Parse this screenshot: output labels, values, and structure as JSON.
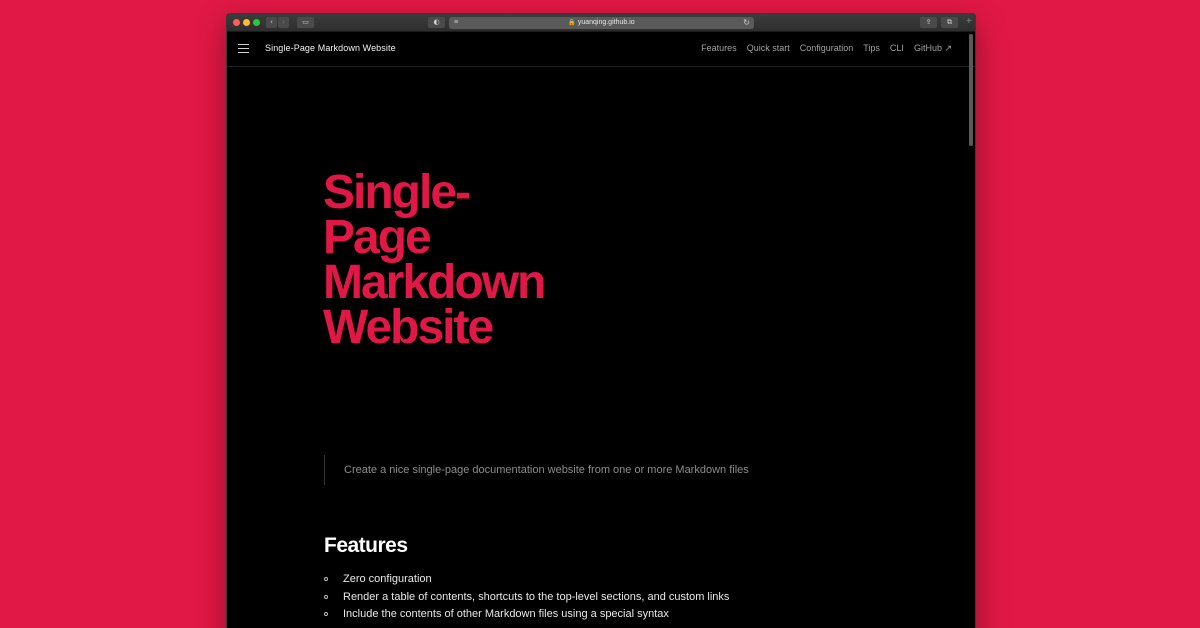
{
  "browser": {
    "url": "yuanqing.github.io"
  },
  "nav": {
    "site_title": "Single-Page Markdown Website",
    "links": [
      "Features",
      "Quick start",
      "Configuration",
      "Tips",
      "CLI",
      "GitHub ↗"
    ]
  },
  "hero": {
    "lines": [
      "Single-",
      "Page",
      "Markdown",
      "Website"
    ]
  },
  "subtitle": "Create a nice single-page documentation website from one or more Markdown files",
  "features": {
    "heading": "Features",
    "items": [
      "Zero configuration",
      "Render a table of contents, shortcuts to the top-level sections, and custom links",
      "Include the contents of other Markdown files using a special syntax"
    ]
  },
  "colors": {
    "brand": "#e11845",
    "background": "#000000"
  }
}
